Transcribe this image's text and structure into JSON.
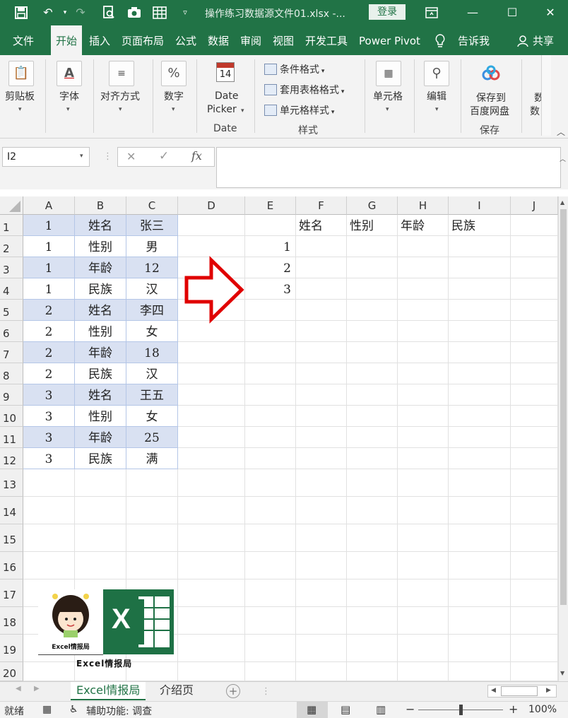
{
  "window": {
    "title": "操作练习数据源文件01.xlsx  -...",
    "login": "登录"
  },
  "tabs": [
    "文件",
    "开始",
    "插入",
    "页面布局",
    "公式",
    "数据",
    "审阅",
    "视图",
    "开发工具",
    "Power Pivot",
    "告诉我",
    "共享"
  ],
  "ribbon": {
    "clipboard": "剪贴板",
    "font": "字体",
    "align": "对齐方式",
    "number": "数字",
    "datepicker": {
      "l1": "Date",
      "l2": "Picker",
      "group": "Date",
      "day": "14"
    },
    "styles": {
      "cond": "条件格式",
      "table": "套用表格格式",
      "cell": "单元格样式",
      "group": "样式"
    },
    "cells": "单元格",
    "edit": "编辑",
    "baidu": {
      "l1": "保存到",
      "l2": "百度网盘",
      "group": "保存"
    },
    "more": {
      "l1": "数",
      "l2": "数"
    }
  },
  "namebox": "I2",
  "columns": [
    "A",
    "B",
    "C",
    "D",
    "E",
    "F",
    "G",
    "H",
    "I",
    "J"
  ],
  "rows": [
    "1",
    "2",
    "3",
    "4",
    "5",
    "6",
    "7",
    "8",
    "9",
    "10",
    "11",
    "12",
    "13",
    "14",
    "15",
    "16",
    "17",
    "18",
    "19",
    "20"
  ],
  "source_table": [
    [
      "1",
      "姓名",
      "张三"
    ],
    [
      "1",
      "性别",
      "男"
    ],
    [
      "1",
      "年龄",
      "12"
    ],
    [
      "1",
      "民族",
      "汉"
    ],
    [
      "2",
      "姓名",
      "李四"
    ],
    [
      "2",
      "性别",
      "女"
    ],
    [
      "2",
      "年龄",
      "18"
    ],
    [
      "2",
      "民族",
      "汉"
    ],
    [
      "3",
      "姓名",
      "王五"
    ],
    [
      "3",
      "性别",
      "女"
    ],
    [
      "3",
      "年龄",
      "25"
    ],
    [
      "3",
      "民族",
      "满"
    ]
  ],
  "e_column": [
    "1",
    "2",
    "3"
  ],
  "target_headers": [
    "姓名",
    "性别",
    "年龄",
    "民族"
  ],
  "logo": {
    "small_caption": "Excel情报局",
    "caption": "Excel情报局",
    "badge": "X"
  },
  "sheets": [
    "Excel情报局",
    "介绍页"
  ],
  "status": {
    "ready": "就绪",
    "access": "辅助功能: 调查",
    "zoom": "100%"
  }
}
